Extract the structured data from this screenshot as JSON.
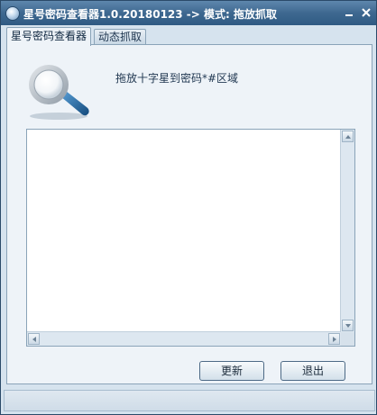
{
  "window": {
    "title": "星号密码查看器1.0.20180123 -> 模式: 拖放抓取",
    "icon": "app-icon",
    "controls": {
      "minimize": "minimize-icon",
      "close": "close-icon"
    }
  },
  "tabs": [
    {
      "label": "星号密码查看器",
      "active": true
    },
    {
      "label": "动态抓取",
      "active": false
    }
  ],
  "panel": {
    "icon": "magnifier-icon",
    "instruction": "拖放十字星到密码*#区域",
    "output_text": ""
  },
  "buttons": {
    "refresh": "更新",
    "exit": "退出"
  },
  "colors": {
    "titlebar": "#3e6890",
    "window_bg": "#d6e3ee",
    "panel_bg": "#eef3f8",
    "magnifier_handle": "#1d5f99"
  }
}
